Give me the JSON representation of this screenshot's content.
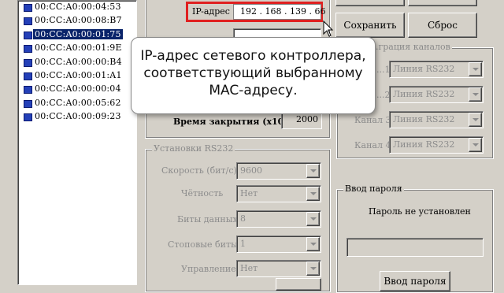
{
  "mac_list": {
    "items": [
      {
        "mac": "00:CC:A0:00:04:53",
        "selected": false
      },
      {
        "mac": "00:CC:A0:00:08:B7",
        "selected": false
      },
      {
        "mac": "00:CC:A0:00:01:75",
        "selected": true
      },
      {
        "mac": "00:CC:A0:00:01:9E",
        "selected": false
      },
      {
        "mac": "00:CC:A0:00:00:B4",
        "selected": false
      },
      {
        "mac": "00:CC:A0:00:01:A1",
        "selected": false
      },
      {
        "mac": "00:CC:A0:00:00:04",
        "selected": false
      },
      {
        "mac": "00:CC:A0:00:05:62",
        "selected": false
      },
      {
        "mac": "00:CC:A0:00:09:23",
        "selected": false
      }
    ]
  },
  "network": {
    "ip_label": "IP-адрес",
    "ip_value": "192 . 168 . 139 . 66",
    "close_time_label": "Время закрытия (x10мс)",
    "close_time_value": "2000"
  },
  "buttons": {
    "save": "Сохранить",
    "reset": "Сброс",
    "password": "Ввод пароля"
  },
  "rs232": {
    "legend": "Установки RS232",
    "speed_label": "Скорость (бит/с)",
    "speed_value": "9600",
    "parity_label": "Чётность",
    "parity_value": "Нет",
    "data_bits_label": "Биты данных",
    "data_bits_value": "8",
    "stop_bits_label": "Стоповые биты",
    "stop_bits_value": "1",
    "flow_label": "Управление",
    "flow_value": "Нет"
  },
  "channels": {
    "legend": "...грация каналов",
    "rows": [
      {
        "label": "...1",
        "value": "Линия RS232"
      },
      {
        "label": "...2",
        "value": "Линия RS232"
      },
      {
        "label": "Канал 3",
        "value": "Линия RS232"
      },
      {
        "label": "Канал 4",
        "value": "Линия RS232"
      }
    ]
  },
  "password": {
    "legend": "Ввод пароля",
    "status": "Пароль не установлен"
  },
  "tooltip": {
    "line1": "IP-адрес сетевого контроллера,",
    "line2": "соответствующий выбранному",
    "line3": "MAC-адресу."
  },
  "colors": {
    "highlight_frame": "#e02020",
    "selection": "#0a246a",
    "window_bg": "#d4d0c8"
  }
}
